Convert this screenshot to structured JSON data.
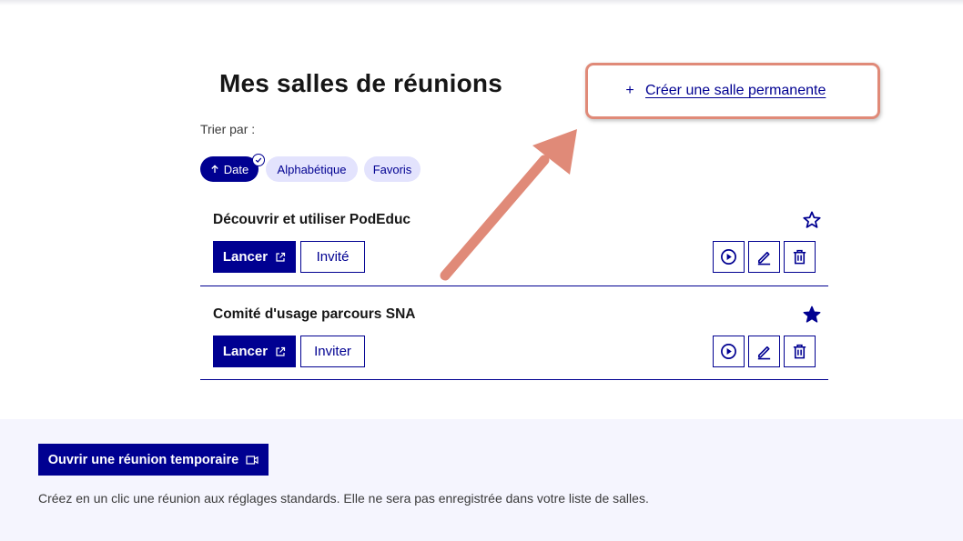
{
  "page": {
    "title": "Mes salles de réunions",
    "create_room": {
      "icon": "plus-icon",
      "plus": "+",
      "label": "Créer une salle permanente"
    }
  },
  "sort": {
    "label": "Trier par :",
    "options": [
      {
        "label": "Date",
        "icon": "arrow-up-icon",
        "selected": true
      },
      {
        "label": "Alphabétique",
        "selected": false
      },
      {
        "label": "Favoris",
        "selected": false
      }
    ]
  },
  "rooms": [
    {
      "name": "Découvrir et utiliser PodEduc",
      "favorite": false,
      "launch_label": "Lancer",
      "invite_label": "Invité",
      "actions": [
        "play-icon",
        "edit-icon",
        "delete-icon"
      ]
    },
    {
      "name": "Comité d'usage parcours SNA",
      "favorite": true,
      "launch_label": "Lancer",
      "invite_label": "Inviter",
      "actions": [
        "play-icon",
        "edit-icon",
        "delete-icon"
      ]
    }
  ],
  "temporary": {
    "button_label": "Ouvrir une réunion temporaire",
    "description": "Créez en un clic une réunion aux réglages standards. Elle ne sera pas enregistrée dans votre liste de salles."
  },
  "colors": {
    "primary": "#000091",
    "chip_inactive": "#e3e3fd",
    "annotation": "#e08a78",
    "footer_bg": "#f5f5fe"
  }
}
